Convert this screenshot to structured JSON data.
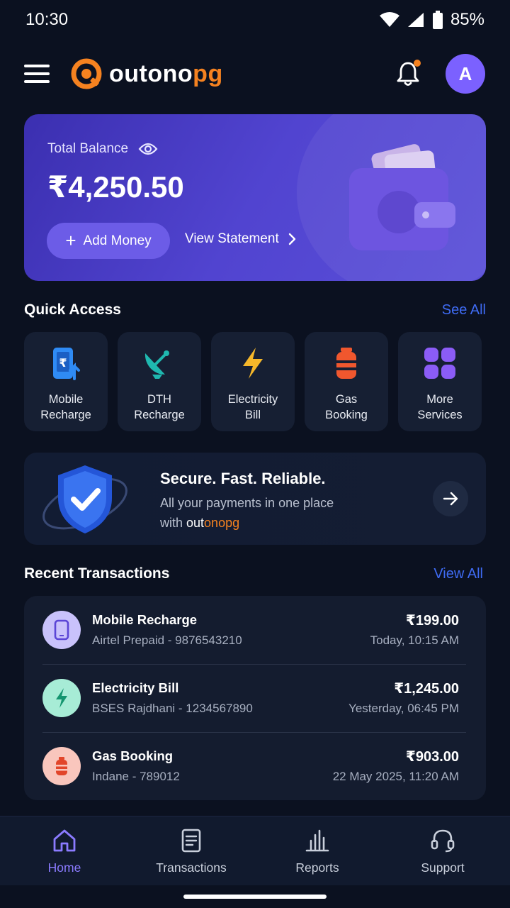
{
  "status_bar": {
    "time": "10:30",
    "battery": "85%"
  },
  "header": {
    "logo_part1": "outono",
    "logo_part2": "pg",
    "avatar_initial": "A",
    "brand_color": "#f58220"
  },
  "balance": {
    "label": "Total Balance",
    "amount": "₹4,250.50",
    "add_money": "Add Money",
    "view_statement": "View Statement"
  },
  "quick_access": {
    "title": "Quick Access",
    "see_all": "See All",
    "items": [
      {
        "label": "Mobile\nRecharge",
        "icon": "mobile-recharge-icon",
        "color": "#2f8bf5"
      },
      {
        "label": "DTH\nRecharge",
        "icon": "satellite-dish-icon",
        "color": "#1fb8b0"
      },
      {
        "label": "Electricity\nBill",
        "icon": "lightning-icon",
        "color": "#f5b72a"
      },
      {
        "label": "Gas\nBooking",
        "icon": "gas-cylinder-icon",
        "color": "#f0572e"
      },
      {
        "label": "More\nServices",
        "icon": "grid-icon",
        "color": "#8b5cf6"
      }
    ]
  },
  "promo": {
    "title": "Secure. Fast. Reliable.",
    "line1": "All your payments in one place",
    "line2_prefix": "with ",
    "brand_part1": "out",
    "brand_part2": "onopg"
  },
  "recent": {
    "title": "Recent Transactions",
    "view_all": "View All",
    "transactions": [
      {
        "name": "Mobile Recharge",
        "detail": "Airtel Prepaid - 9876543210",
        "amount": "₹199.00",
        "time": "Today, 10:15 AM",
        "icon": "phone-icon"
      },
      {
        "name": "Electricity Bill",
        "detail": "BSES Rajdhani - 1234567890",
        "amount": "₹1,245.00",
        "time": "Yesterday, 06:45 PM",
        "icon": "lightning-icon"
      },
      {
        "name": "Gas Booking",
        "detail": "Indane - 789012",
        "amount": "₹903.00",
        "time": "22 May 2025, 11:20 AM",
        "icon": "gas-cylinder-icon"
      }
    ]
  },
  "bottom_nav": {
    "items": [
      {
        "label": "Home",
        "icon": "home-icon",
        "active": true
      },
      {
        "label": "Transactions",
        "icon": "receipt-icon",
        "active": false
      },
      {
        "label": "Reports",
        "icon": "bar-chart-icon",
        "active": false
      },
      {
        "label": "Support",
        "icon": "headset-icon",
        "active": false
      }
    ]
  }
}
